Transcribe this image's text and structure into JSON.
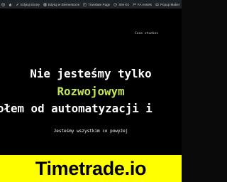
{
  "admin_bar": {
    "items": [
      {
        "icon": "wordpress-icon",
        "label": ""
      },
      {
        "icon": "home-icon",
        "label": ""
      },
      {
        "icon": "edit-icon",
        "label": "Edytuj stronę"
      },
      {
        "icon": "elementor-icon",
        "label": "Edytuj w Elementorze"
      },
      {
        "icon": "translate-icon",
        "label": "Translate Page"
      },
      {
        "icon": "site-kit-icon",
        "label": "Site Kit"
      },
      {
        "icon": "fa-icon",
        "label": "FA Assets"
      },
      {
        "icon": "popup-icon",
        "label": "Popup Maker"
      }
    ]
  },
  "hero": {
    "nav_link": "Case studies",
    "headline_line1": "Nie jesteśmy tylko",
    "headline_line2": "Rozwojowym",
    "headline_line3": "ołem od automatyzacji i",
    "subtitle": "Jesteśmy wszystkim co powyżej",
    "accent_color": "#c6e65a"
  },
  "banner": {
    "text": "Timetrade.io",
    "background": "#ffff00"
  }
}
